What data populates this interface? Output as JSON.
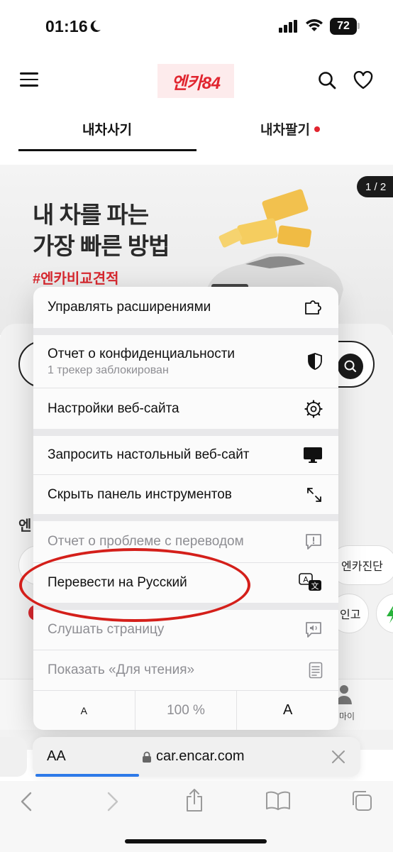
{
  "status_bar": {
    "time": "01:16",
    "battery": "72"
  },
  "header": {
    "logo_text": "엔카84"
  },
  "tabs": [
    {
      "label": "내차사기"
    },
    {
      "label": "내차팔기"
    }
  ],
  "banner": {
    "line1": "내 차를 파는",
    "line2": "가장 빠른 방법",
    "tag": "#엔카비교견적",
    "counter": "1 / 2"
  },
  "page_behind": {
    "section_initial": "엔",
    "chip_label": "엔카진단",
    "chip2_label": "인고",
    "my_label": "마이"
  },
  "menu": {
    "manage_extensions": "Управлять расширениями",
    "privacy_report": "Отчет о конфиденциальности",
    "privacy_sub": "1 трекер заблокирован",
    "website_settings": "Настройки веб-сайта",
    "request_desktop": "Запросить настольный веб-сайт",
    "hide_toolbar": "Скрыть панель инструментов",
    "report_translation": "Отчет о проблеме с переводом",
    "translate": "Перевести на Русский",
    "listen_page": "Слушать страницу",
    "show_reader": "Показать «Для чтения»",
    "zoom_small": "A",
    "zoom_level": "100 %",
    "zoom_big": "A"
  },
  "address_bar": {
    "aa": "AA",
    "url": "car.encar.com"
  },
  "colors": {
    "accent": "#e1252f",
    "annotation": "#d41f1a",
    "progress": "#2d79e8"
  }
}
